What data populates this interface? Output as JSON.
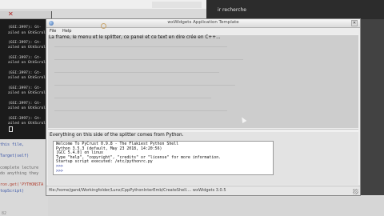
{
  "background_editor": {
    "search_placeholder": "ir recherche",
    "code_lines": [
      {
        "text": "this file,",
        "style": "blue"
      },
      {
        "text": "",
        "style": ""
      },
      {
        "text": "Target(self)",
        "style": "blue"
      },
      {
        "text": "",
        "style": ""
      },
      {
        "text": "complete lecture",
        "style": ""
      },
      {
        "text": "do anything they",
        "style": ""
      },
      {
        "text": "",
        "style": ""
      },
      {
        "text": "ron.get('PYTHONSTA",
        "style": "red"
      },
      {
        "text": "topScript)",
        "style": "blue"
      }
    ],
    "line_number": "82"
  },
  "terminal": {
    "lines": [
      "",
      "(GSI:3997): Gt-",
      "ailed on GtkScroll",
      "",
      "(GSI:3997): Gt-",
      "ailed on GtkScroll",
      "",
      "(GSI:3997): Gt-",
      "ailed on GtkScroll",
      "",
      "(GSI:3997): Gt-",
      "ailed on GtkScroll",
      "",
      "(GSI:3997): Gt-",
      "ailed on GtkScroll",
      "",
      "(GSI:3997): Gt-",
      "ailed on GtkScroll",
      "",
      "(GSI:3997): Gt-",
      "ailed on GtkScroll"
    ]
  },
  "wx_window": {
    "title": "wxWidgets Application Template",
    "menus": [
      "File",
      "Help"
    ],
    "top_panel_label": "La frame, le menu et le splitter, ce panel et ce text en dire crée en C++...",
    "bottom_panel_label": "Everything on this side of the splitter comes from Python.",
    "shell_lines": [
      {
        "text": "Welcome To PyCrust 0.9.8 - The Flakiest Python Shell",
        "style": ""
      },
      {
        "text": "Python 3.5.3 (default, May 23 2018, 14:20:56)",
        "style": ""
      },
      {
        "text": "[GCC 5.4.0] on linux",
        "style": ""
      },
      {
        "text": "Type \"help\", \"copyright\", \"credits\" or \"license\" for more information.",
        "style": ""
      },
      {
        "text": "Startup script executed: /etc/pythonrc.py",
        "style": ""
      },
      {
        "text": ">>>",
        "style": "blue"
      },
      {
        "text": ">>>",
        "style": "blue"
      }
    ],
    "status_text": "file:/home/gand/Workingfolder/Lunx/CppPythonInterEmb/CreateShell....  wxWidgets 3.0.5"
  }
}
